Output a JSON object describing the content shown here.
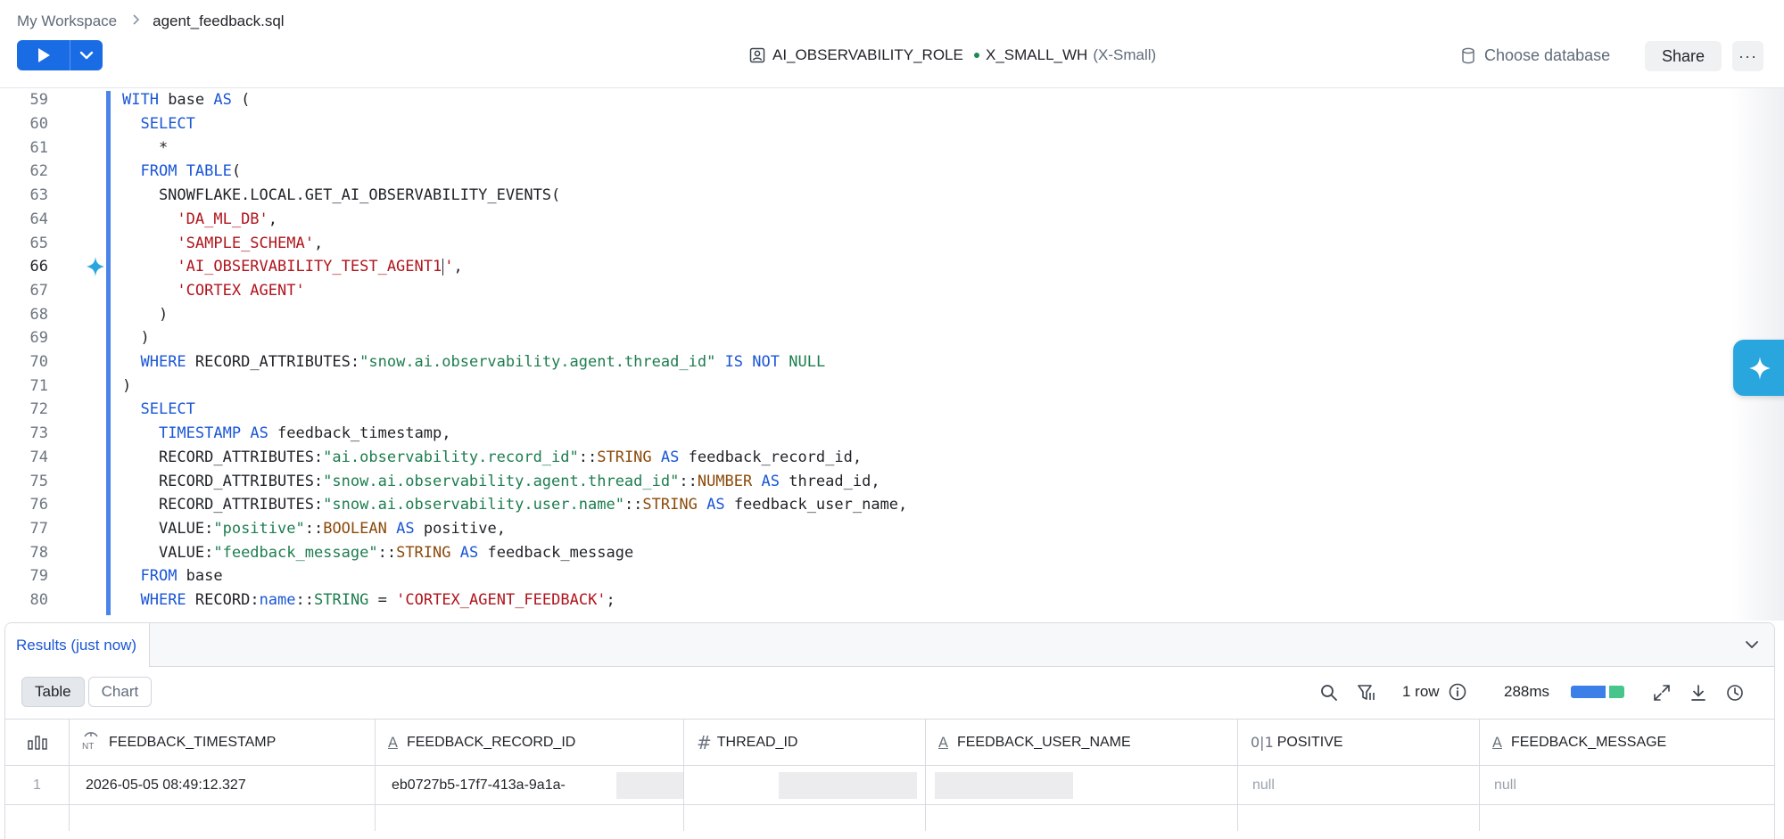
{
  "breadcrumb": {
    "workspace": "My Workspace",
    "separator": ">",
    "file": "agent_feedback.sql"
  },
  "toolbar": {
    "role": "AI_OBSERVABILITY_ROLE",
    "warehouse": "X_SMALL_WH",
    "warehouse_size": "(X-Small)",
    "database": "Choose database",
    "share": "Share",
    "more": "···"
  },
  "editor": {
    "line_numbers": [
      "59",
      "60",
      "61",
      "62",
      "63",
      "64",
      "65",
      "66",
      "67",
      "68",
      "69",
      "70",
      "71",
      "72",
      "73",
      "74",
      "75",
      "76",
      "77",
      "78",
      "79",
      "80"
    ],
    "cursor_line": "66"
  },
  "results": {
    "tab": "Results (just now)",
    "views": [
      "Table",
      "Chart"
    ],
    "active_view": "Table",
    "row_count": "1 row",
    "duration": "288ms",
    "columns": [
      {
        "icon": "timestamp-icon",
        "name": "FEEDBACK_TIMESTAMP"
      },
      {
        "icon": "text-type-icon",
        "name": "FEEDBACK_RECORD_ID"
      },
      {
        "icon": "number-type-icon",
        "name": "THREAD_ID"
      },
      {
        "icon": "text-type-icon",
        "name": "FEEDBACK_USER_NAME"
      },
      {
        "icon": "boolean-type-icon",
        "name": "POSITIVE"
      },
      {
        "icon": "text-type-icon",
        "name": "FEEDBACK_MESSAGE"
      }
    ],
    "rows": [
      {
        "index": "1",
        "feedback_timestamp": "2026-05-05 08:49:12.327",
        "feedback_record_id": "eb0727b5-17f7-413a-9a1a-",
        "positive": "null",
        "feedback_message": "null"
      }
    ],
    "icons": {
      "boolean_glyph": "0|1",
      "number_glyph": "#",
      "text_glyph": "A"
    }
  },
  "colors": {
    "accent": "#1a6ce4",
    "keyword": "#1a56d6",
    "string": "#b0151d",
    "quoted_identifier": "#1d7d4f",
    "type": "#8b4a0a",
    "ai_button": "#2aa6df"
  }
}
